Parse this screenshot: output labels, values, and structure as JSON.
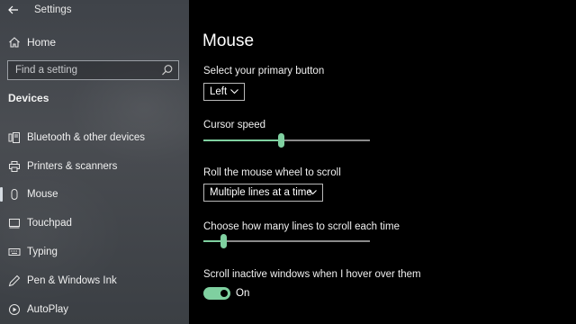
{
  "window": {
    "title": "Settings"
  },
  "sidebar": {
    "home_label": "Home",
    "search_placeholder": "Find a setting",
    "section_title": "Devices",
    "items": [
      {
        "label": "Bluetooth & other devices",
        "icon": "bluetooth-devices-icon"
      },
      {
        "label": "Printers & scanners",
        "icon": "printer-icon"
      },
      {
        "label": "Mouse",
        "icon": "mouse-icon",
        "selected": true
      },
      {
        "label": "Touchpad",
        "icon": "touchpad-icon"
      },
      {
        "label": "Typing",
        "icon": "keyboard-icon"
      },
      {
        "label": "Pen & Windows Ink",
        "icon": "pen-icon"
      },
      {
        "label": "AutoPlay",
        "icon": "autoplay-icon"
      }
    ]
  },
  "main": {
    "title": "Mouse",
    "primary_button": {
      "label": "Select your primary button",
      "value": "Left"
    },
    "cursor_speed": {
      "label": "Cursor speed",
      "value": 0.47
    },
    "scroll_wheel": {
      "label": "Roll the mouse wheel to scroll",
      "value": "Multiple lines at a time"
    },
    "scroll_lines": {
      "label": "Choose how many lines to scroll each time",
      "value": 0.12
    },
    "inactive_scroll": {
      "label": "Scroll inactive windows when I hover over them",
      "state": "On",
      "on": true
    }
  },
  "colors": {
    "accent": "#7fd0a0",
    "sidebar_bg": "#45484d",
    "main_bg": "#000000"
  }
}
